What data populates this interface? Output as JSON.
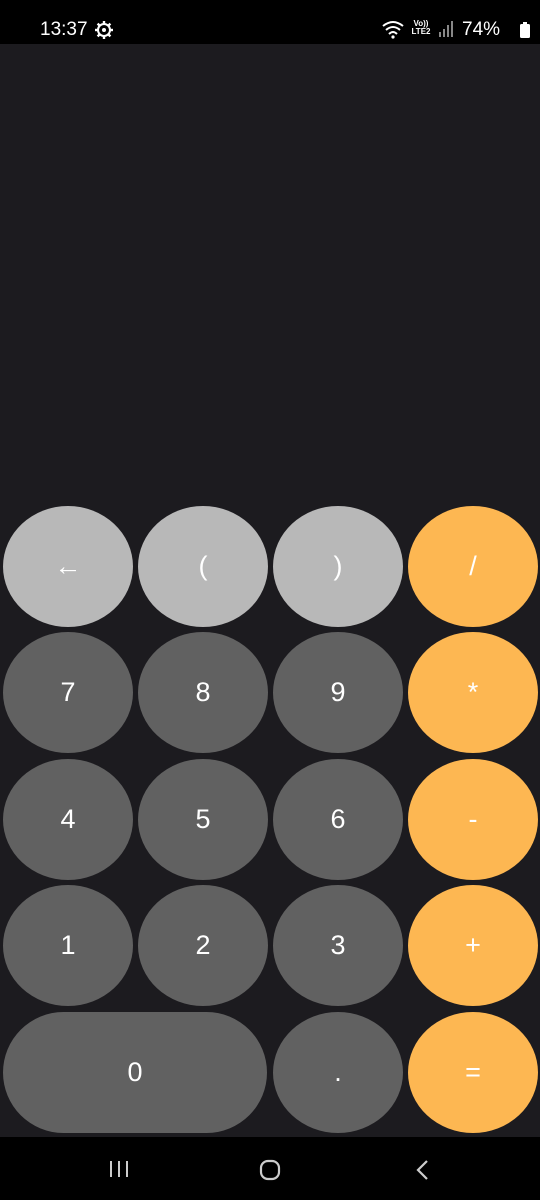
{
  "status_bar": {
    "time": "13:37",
    "network_label_top": "Vo))",
    "network_label_bottom": "LTE2",
    "battery": "74%"
  },
  "display": {
    "expression": ""
  },
  "keys": [
    {
      "label": "←",
      "name": "backspace-button",
      "style": "light"
    },
    {
      "label": "(",
      "name": "open-paren-button",
      "style": "light"
    },
    {
      "label": ")",
      "name": "close-paren-button",
      "style": "light"
    },
    {
      "label": "/",
      "name": "divide-button",
      "style": "orange"
    },
    {
      "label": "7",
      "name": "digit-7-button",
      "style": "dark"
    },
    {
      "label": "8",
      "name": "digit-8-button",
      "style": "dark"
    },
    {
      "label": "9",
      "name": "digit-9-button",
      "style": "dark"
    },
    {
      "label": "*",
      "name": "multiply-button",
      "style": "orange"
    },
    {
      "label": "4",
      "name": "digit-4-button",
      "style": "dark"
    },
    {
      "label": "5",
      "name": "digit-5-button",
      "style": "dark"
    },
    {
      "label": "6",
      "name": "digit-6-button",
      "style": "dark"
    },
    {
      "label": "-",
      "name": "subtract-button",
      "style": "orange"
    },
    {
      "label": "1",
      "name": "digit-1-button",
      "style": "dark"
    },
    {
      "label": "2",
      "name": "digit-2-button",
      "style": "dark"
    },
    {
      "label": "3",
      "name": "digit-3-button",
      "style": "dark"
    },
    {
      "label": "+",
      "name": "add-button",
      "style": "orange"
    },
    {
      "label": "0",
      "name": "digit-0-button",
      "style": "dark"
    },
    {
      "label": ".",
      "name": "decimal-button",
      "style": "dark"
    },
    {
      "label": "=",
      "name": "equals-button",
      "style": "orange"
    }
  ],
  "colors": {
    "background": "#1c1b1f",
    "key_light": "#b8b8b8",
    "key_dark": "#616161",
    "key_orange": "#fdb752"
  },
  "nav_bar": {
    "icons": [
      "recent-apps-icon",
      "home-icon",
      "back-icon"
    ]
  }
}
